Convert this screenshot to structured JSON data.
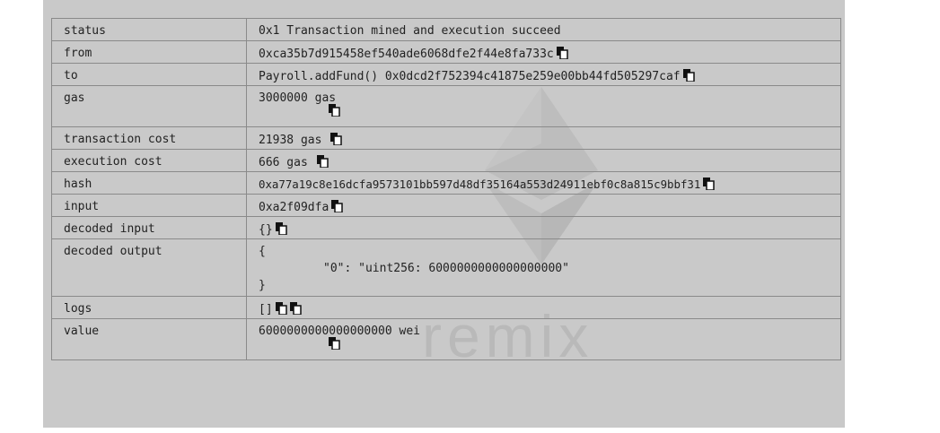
{
  "header_fragment": "",
  "watermark_text": "remix",
  "rows": [
    {
      "key": "status",
      "value": "0x1 Transaction mined and execution succeed"
    },
    {
      "key": "from",
      "value": "0xca35b7d915458ef540ade6068dfe2f44e8fa733c"
    },
    {
      "key": "to",
      "value": "Payroll.addFund() 0x0dcd2f752394c41875e259e00bb44fd505297caf"
    },
    {
      "key": "gas",
      "value": "3000000 gas"
    },
    {
      "key": "transaction cost",
      "value": "21938 gas"
    },
    {
      "key": "execution cost",
      "value": "666 gas"
    },
    {
      "key": "hash",
      "value": "0xa77a19c8e16dcfa9573101bb597d48df35164a553d24911ebf0c8a815c9bbf31"
    },
    {
      "key": "input",
      "value": "0xa2f09dfa"
    },
    {
      "key": "decoded input",
      "value": "{}"
    },
    {
      "key": "decoded output",
      "open": "{",
      "body": "\"0\": \"uint256: 6000000000000000000\"",
      "close": "}"
    },
    {
      "key": "logs",
      "value": "[]"
    },
    {
      "key": "value",
      "value": "6000000000000000000 wei"
    }
  ],
  "icons": {
    "copy": "copy-to-clipboard-icon"
  }
}
